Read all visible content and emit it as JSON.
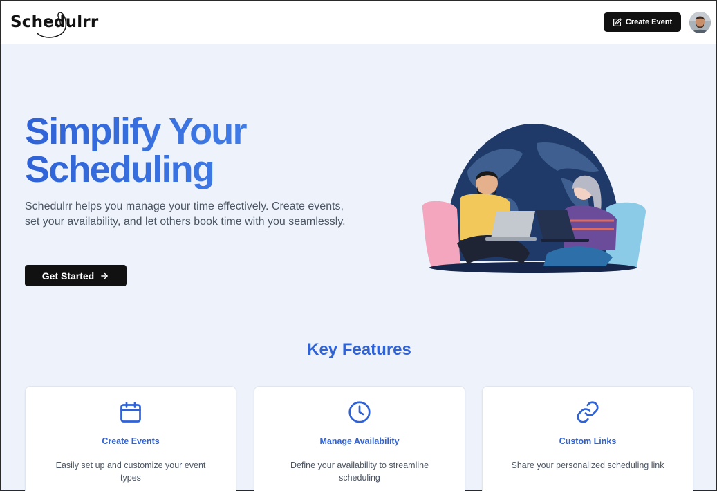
{
  "header": {
    "logo_text": "Schedulrr",
    "create_event_label": "Create Event"
  },
  "hero": {
    "title_line1": "Simplify Your",
    "title_line2": "Scheduling",
    "description": "Schedulrr helps you manage your time effectively. Create events, set your availability, and let others book time with you seamlessly.",
    "cta_label": "Get Started"
  },
  "features": {
    "heading": "Key Features",
    "items": [
      {
        "title": "Create Events",
        "description": "Easily set up and customize your event types",
        "icon": "calendar-icon"
      },
      {
        "title": "Manage Availability",
        "description": "Define your availability to streamline scheduling",
        "icon": "clock-icon"
      },
      {
        "title": "Custom Links",
        "description": "Share your personalized scheduling link",
        "icon": "link-icon"
      }
    ]
  },
  "colors": {
    "accent": "#2f62d6",
    "background": "#eef3fb",
    "button": "#111111"
  }
}
